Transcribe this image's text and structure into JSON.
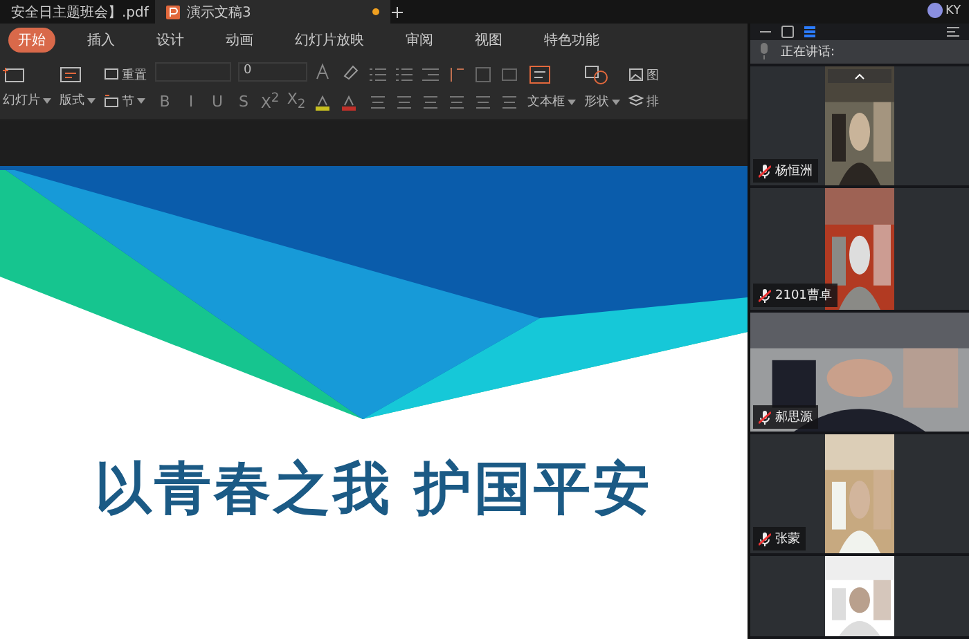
{
  "tabs": [
    {
      "label": "安全日主题班会】.pdf",
      "kind": "pdf",
      "selected": false
    },
    {
      "label": "演示文稿3",
      "kind": "ppt",
      "selected": true
    }
  ],
  "user_initials": "KY",
  "menu": [
    {
      "label": "开始",
      "selected": true
    },
    {
      "label": "插入",
      "selected": false
    },
    {
      "label": "设计",
      "selected": false
    },
    {
      "label": "动画",
      "selected": false
    },
    {
      "label": "幻灯片放映",
      "selected": false
    },
    {
      "label": "审阅",
      "selected": false
    },
    {
      "label": "视图",
      "selected": false
    },
    {
      "label": "特色功能",
      "selected": false
    }
  ],
  "toolbar": {
    "new_slide": "幻灯片",
    "layout": "版式",
    "reset": "重置",
    "section": "节",
    "font_size": "0",
    "format_buttons": [
      "B",
      "I",
      "U",
      "S",
      "X$^{2}$",
      "X$_{2}$"
    ],
    "text_box": "文本框",
    "shape": "形状",
    "picture": "图",
    "arrange": "排"
  },
  "slide": {
    "title": "以青春之我 护国平安"
  },
  "meeting": {
    "speaking_label": "正在讲话:",
    "participants": [
      {
        "name": "杨恒洲",
        "kind": "narrow",
        "muted": true
      },
      {
        "name": "2101曹卓",
        "kind": "narrow",
        "muted": true
      },
      {
        "name": "郝思源",
        "kind": "wide",
        "muted": true
      },
      {
        "name": "张蒙",
        "kind": "narrow",
        "muted": true
      },
      {
        "kind": "narrow",
        "muted": false
      }
    ]
  }
}
